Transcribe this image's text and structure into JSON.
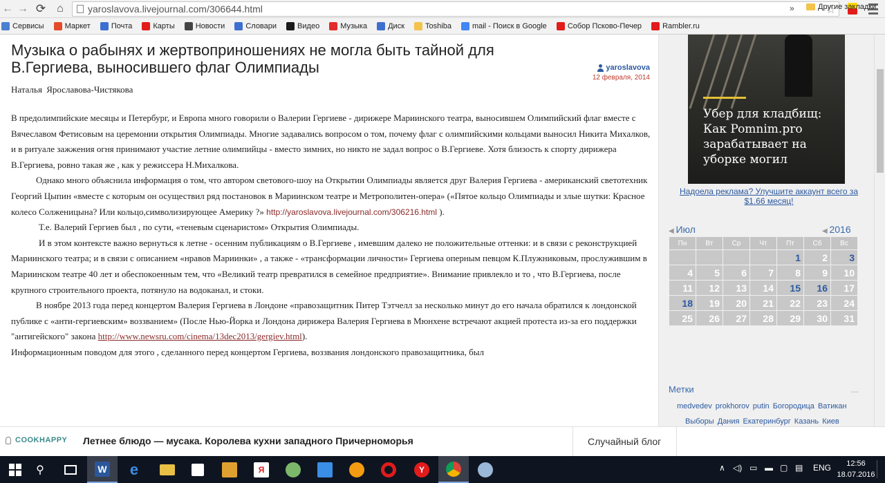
{
  "browser": {
    "url": "yaroslavova.livejournal.com/306644.html",
    "bookmarks": [
      {
        "label": "Сервисы",
        "icon": "apps-icon",
        "color": "#4a7fd1"
      },
      {
        "label": "Маркет",
        "icon": "market-icon",
        "color": "#e24c2b"
      },
      {
        "label": "Почта",
        "icon": "mail-icon",
        "color": "#3d6fd1"
      },
      {
        "label": "Карты",
        "icon": "map-pin-icon",
        "color": "#e21b1b"
      },
      {
        "label": "Новости",
        "icon": "news-icon",
        "color": "#444444"
      },
      {
        "label": "Словари",
        "icon": "dictionary-icon",
        "color": "#3d6fd1"
      },
      {
        "label": "Видео",
        "icon": "video-icon",
        "color": "#1a1a1a"
      },
      {
        "label": "Музыка",
        "icon": "music-icon",
        "color": "#e22b2b"
      },
      {
        "label": "Диск",
        "icon": "disk-icon",
        "color": "#3d6fd1"
      },
      {
        "label": "Toshiba",
        "icon": "folder-icon",
        "color": "#f3c34b"
      },
      {
        "label": "mail - Поиск в Google",
        "icon": "google-icon",
        "color": "#4285f4"
      },
      {
        "label": "Собор Псково-Печер",
        "icon": "yandex-icon",
        "color": "#e21b1b"
      },
      {
        "label": "Rambler.ru",
        "icon": "yandex-icon",
        "color": "#e21b1b"
      }
    ],
    "more": "»",
    "other_bookmarks": "Другие закладки"
  },
  "article": {
    "title": "Музыка о рабынях и жертвоприношениях не могла быть тайной для В.Гергиева, выносившего флаг Олимпиады",
    "author": "yaroslavova",
    "date": "12 февраля, 2014",
    "byline": "Наталья  Ярославова-Чистякова",
    "p1": "В  предолимпийские  месяцы и Петербург,   и   Европа  много  говорили  о  Валерии  Гергиеве -  дирижере   Мариинского театра, выносившем  Олимпийский     флаг     вместе  с    Вячеславом  Фетисовым на   церемонии открытия   Олимпиады.  Многие  задавались вопросом  о том, почему    флаг с олимпийскими кольцами выносил Никита     Михалков,  и  в     ритуале       зажжения  огня принимают  участие    летние  олимпийцы  -   вместо  зимних,  но     никто     не задал вопрос  о В.Гергиеве. Хотя    близость к спорту  дирижера В.Гергиева,   ровно  такая  же , как у  режиссера   Н.Михалкова.",
    "p2_text": "Однако  много    объяснила       информация о том,  что  автором светового-шоу  на  Открытии   Олимпиады    является    друг Валерия  Гергиева  -  американский    светотехник   Георгий   Цыпин «вместе с которым он осуществил ряд постановок в Мариинском театре и Метрополитен-опера»  («Пятое кольцо Олимпиады и злые шутки: Красное колесо Солженицына? Или кольцо,символизирующее Америку ?» ",
    "p2_link": "http://yaroslavova.livejournal.com/306216.html",
    "p2_tail": " ).",
    "p3": "Т.е.    Валерий   Гергиев   был , по сути,  «теневым сценаристом»  Открытия  Олимпиады.",
    "p4": "И  в  этом   контексте   важно  вернуться   к летне - осенним публикациям  о  В.Гергиеве , имевшим    далеко не  положительные оттенки: и в связи с   реконструкцией   Мариинского театра;   и в связи  с   описанием  «нравов Мариинки» , а  также -     «трансформации личности» Гергиева   оперным    певцом  К.Плужниковым,  прослужившим в Мариинском театре    40 лет и обеспокоенным  тем, что   «Великий театр превратился в семейное предприятие». Внимание  привлекло и то ,  что    В.Гергиева,   после    крупного строительного проекта,    потянуло на  водоканал,  и   стоки.",
    "p5_text": "В ноябре 2013 года    перед    концертом Валерия   Гергиева в Лондоне    «правозащитник Питер Тэтчелл за  несколько минут до его начала  обратился       к лондонской  публике с  «анти-гергиевским»      воззванием»  (После Нью-Йорка и Лондона дирижера Валерия Гергиева в Мюнхене встречают акцией протеста из-за его поддержки \"антигейского\" закона ",
    "p5_link": "http://www.newsru.com/cinema/13dec2013/gergiev.html",
    "p5_tail": ").",
    "p6": "Информационным   поводом для   этого  ,  сделанного  перед концертом Гергиева,   воззвания    лондонского  правозащитника,  был"
  },
  "sidebar": {
    "ad_text": "Убер для кладбищ: Как Pomnim.pro зарабатывает на уборке могил",
    "ad_upgrade": "Надоела реклама? Улучшите аккаунт всего за $1.66 месяц!",
    "calendar": {
      "month": "Июл",
      "year": "2016",
      "weekdays": [
        "Пн",
        "Вт",
        "Ср",
        "Чт",
        "Пт",
        "Сб",
        "Вс"
      ],
      "weeks": [
        [
          "",
          "",
          "",
          "",
          "1",
          "2",
          "3"
        ],
        [
          "4",
          "5",
          "6",
          "7",
          "8",
          "9",
          "10"
        ],
        [
          "11",
          "12",
          "13",
          "14",
          "15",
          "16",
          "17"
        ],
        [
          "18",
          "19",
          "20",
          "21",
          "22",
          "23",
          "24"
        ],
        [
          "25",
          "26",
          "27",
          "28",
          "29",
          "30",
          "31"
        ]
      ],
      "linked_days": [
        "1",
        "3",
        "15",
        "16",
        "18"
      ]
    },
    "tags_title": "Метки",
    "tags_more": "...",
    "tags_line1": "medvedev  prokhorov  putin  Богородица  Ватикан",
    "tags_line2": "Выборы  Дания  Екатеринбург  Казань  Киев"
  },
  "banner": {
    "site": "COOKHAPPY",
    "headline": "Летнее блюдо — мусака. Королева кухни западного Причерноморья",
    "random": "Случайный блог"
  },
  "taskbar": {
    "lang": "ENG",
    "time": "12:56",
    "date": "18.07.2016"
  }
}
